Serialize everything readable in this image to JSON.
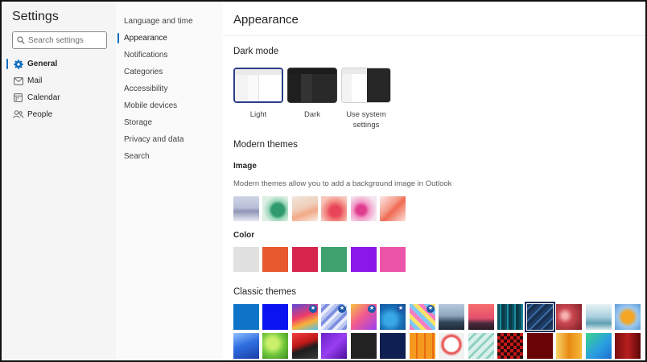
{
  "app": {
    "title": "Settings"
  },
  "search": {
    "placeholder": "Search settings"
  },
  "nav": {
    "items": [
      {
        "label": "General",
        "icon": "gear-icon",
        "active": true
      },
      {
        "label": "Mail",
        "icon": "mail-icon",
        "active": false
      },
      {
        "label": "Calendar",
        "icon": "calendar-icon",
        "active": false
      },
      {
        "label": "People",
        "icon": "people-icon",
        "active": false
      }
    ]
  },
  "subnav": {
    "items": [
      {
        "label": "Language and time",
        "active": false
      },
      {
        "label": "Appearance",
        "active": true
      },
      {
        "label": "Notifications",
        "active": false
      },
      {
        "label": "Categories",
        "active": false
      },
      {
        "label": "Accessibility",
        "active": false
      },
      {
        "label": "Mobile devices",
        "active": false
      },
      {
        "label": "Storage",
        "active": false
      },
      {
        "label": "Privacy and data",
        "active": false
      },
      {
        "label": "Search",
        "active": false
      }
    ]
  },
  "main": {
    "title": "Appearance",
    "dark_mode": {
      "heading": "Dark mode",
      "options": [
        {
          "label": "Light",
          "selected": true
        },
        {
          "label": "Dark",
          "selected": false
        },
        {
          "label": "Use system settings",
          "selected": false
        }
      ]
    },
    "modern_themes": {
      "heading": "Modern themes",
      "image_heading": "Image",
      "image_description": "Modern themes allow you to add a background image in Outlook",
      "color_heading": "Color",
      "colors": [
        "#e1e1e1",
        "#e8582f",
        "#d6264d",
        "#3fa26e",
        "#8b18ea",
        "#ec54a8"
      ]
    },
    "classic_themes": {
      "heading": "Classic themes"
    }
  },
  "colors": {
    "accent": "#0f6cbd",
    "selected_border": "#2a3f8a"
  }
}
